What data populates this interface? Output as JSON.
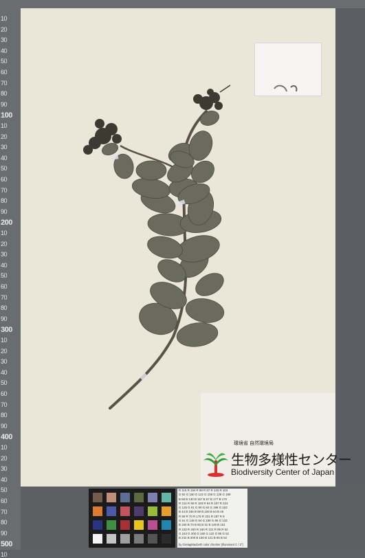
{
  "ruler": {
    "labels": [
      "10",
      "20",
      "30",
      "40",
      "50",
      "60",
      "70",
      "80",
      "90",
      "100",
      "10",
      "20",
      "30",
      "40",
      "50",
      "60",
      "70",
      "80",
      "90",
      "200",
      "10",
      "20",
      "30",
      "40",
      "50",
      "60",
      "70",
      "80",
      "90",
      "300",
      "10",
      "20",
      "30",
      "40",
      "50",
      "60",
      "70",
      "80",
      "90",
      "400",
      "10",
      "20",
      "30",
      "40",
      "50",
      "60",
      "70",
      "80",
      "90",
      "500",
      "10"
    ]
  },
  "label": {
    "agency": "環境省 自然環境局",
    "org_jp": "生物多様性センター",
    "org_en": "Biodiversity Center of Japan"
  },
  "color_card": {
    "swatches": [
      "#735b4d",
      "#c08f79",
      "#5b6e93",
      "#5c6940",
      "#7e80b2",
      "#62b5a7",
      "#dc7c2c",
      "#4a5aa8",
      "#c4545d",
      "#503b6c",
      "#97bd3c",
      "#e5a02c",
      "#2a3282",
      "#3f8e44",
      "#a63034",
      "#e7c51c",
      "#b94f91",
      "#1f86b0",
      "#f4f4f4",
      "#c6c6c6",
      "#a0a0a0",
      "#7a7a7a",
      "#545454",
      "#2b2b2b"
    ]
  },
  "rgb_table": {
    "rows": [
      "R 115  R 194  R  98  R  87  R 133  R 103",
      "G  82  G 150  G 122  G 108  G 128  G 189",
      "B  68  B 130  B 157  B  67  B 177  B 170",
      "R 214  R  80  R 193  R  94  R 157  R 224",
      "G 126  G  91  G  90  G  60  G 188  G 163",
      "B  44  B 166  B  99  B 108  B  64  B  46",
      "R  56  R  70  R 175  R 231  R 187  R   8",
      "G  61  G 148  G  54  G 199  G  86  G 133",
      "B 150  B  73  B  60  B  31  B 149  B 161",
      "R 243  R 200  R 160  R 122  R  85  R  52",
      "G 243  G 200  G 160  G 122  G  85  G  52",
      "B 242  B 200  B 160  B 121  B  85  B  52"
    ],
    "caption": "by GretagMacbeth color checker (Illuminant C / 2°)"
  }
}
